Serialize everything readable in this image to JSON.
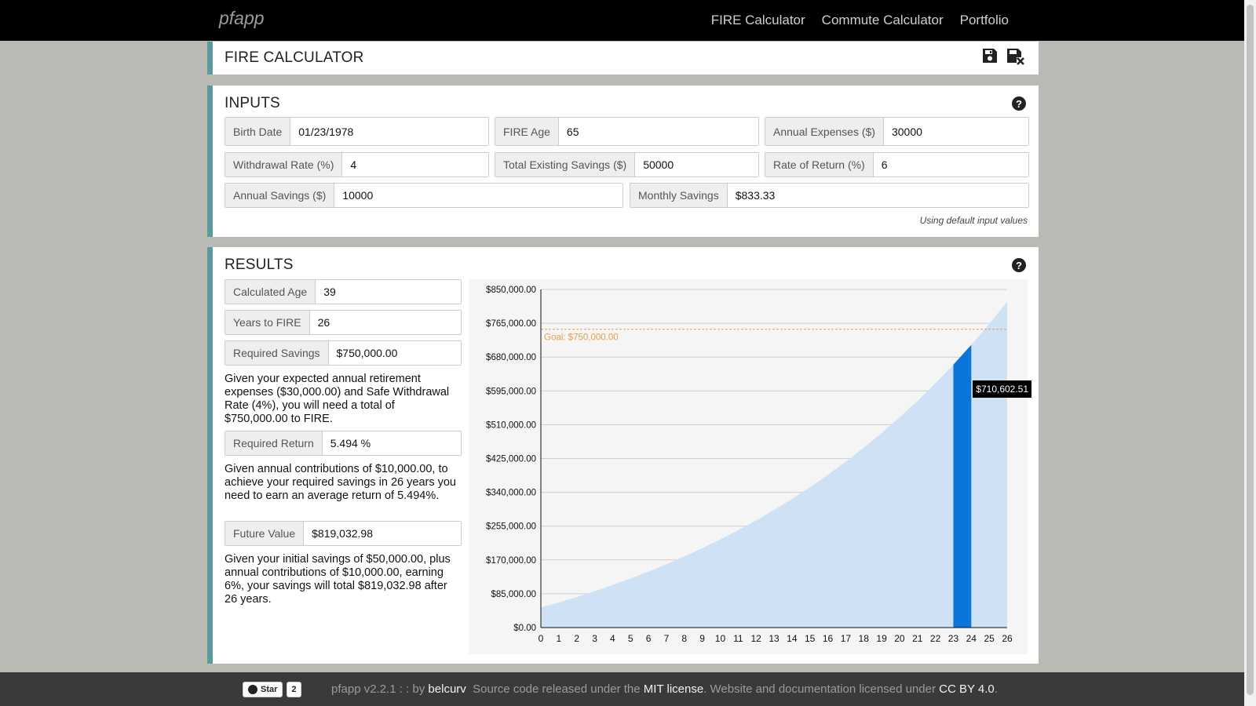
{
  "nav": {
    "brand": "pfapp",
    "links": [
      "FIRE Calculator",
      "Commute Calculator",
      "Portfolio"
    ]
  },
  "header": {
    "title": "FIRE CALCULATOR"
  },
  "inputs": {
    "title": "INPUTS",
    "birth_date": {
      "label": "Birth Date",
      "value": "01/23/1978"
    },
    "fire_age": {
      "label": "FIRE Age",
      "value": "65"
    },
    "annual_expenses": {
      "label": "Annual Expenses ($)",
      "value": "30000"
    },
    "withdrawal_rate": {
      "label": "Withdrawal Rate (%)",
      "value": "4"
    },
    "total_savings": {
      "label": "Total Existing Savings ($)",
      "value": "50000"
    },
    "rate_of_return": {
      "label": "Rate of Return (%)",
      "value": "6"
    },
    "annual_savings": {
      "label": "Annual Savings ($)",
      "value": "10000"
    },
    "monthly_savings": {
      "label": "Monthly Savings",
      "value": "$833.33"
    },
    "note": "Using default input values"
  },
  "results": {
    "title": "RESULTS",
    "calculated_age": {
      "label": "Calculated Age",
      "value": "39"
    },
    "years_to_fire": {
      "label": "Years to FIRE",
      "value": "26"
    },
    "required_savings": {
      "label": "Required Savings",
      "value": "$750,000.00"
    },
    "required_savings_text": "Given your expected annual retirement expenses ($30,000.00) and Safe Withdrawal Rate (4%), you will need a total of $750,000.00 to FIRE.",
    "required_return": {
      "label": "Required Return",
      "value": "5.494 %"
    },
    "required_return_text": "Given annual contributions of $10,000.00, to achieve your required savings in 26 years you need to earn an average return of 5.494%.",
    "future_value": {
      "label": "Future Value",
      "value": "$819,032.98"
    },
    "future_value_text": "Given your initial savings of $50,000.00, plus annual contributions of $10,000.00, earning 6%, your savings will total $819,032.98 after 26 years."
  },
  "chart_data": {
    "type": "area",
    "x": [
      0,
      1,
      2,
      3,
      4,
      5,
      6,
      7,
      8,
      9,
      10,
      11,
      12,
      13,
      14,
      15,
      16,
      17,
      18,
      19,
      20,
      21,
      22,
      23,
      24,
      25,
      26
    ],
    "series": [
      {
        "values": [
          50000,
          63000,
          76780,
          91387,
          106870,
          123290,
          140690,
          159130,
          178680,
          199400,
          221360,
          244640,
          269320,
          295480,
          323210,
          352590,
          383750,
          416770,
          451770,
          488880,
          528210,
          569900,
          614090,
          660940,
          710600,
          763240,
          819030
        ]
      }
    ],
    "highlight": {
      "index": 24,
      "label": "$710,602.51",
      "color": "#0a76d8"
    },
    "goal": {
      "value": 750000,
      "label": "Goal: $750,000.00",
      "color": "#e8a04c"
    },
    "yticks": [
      "$0.00",
      "$85,000.00",
      "$170,000.00",
      "$255,000.00",
      "$340,000.00",
      "$425,000.00",
      "$510,000.00",
      "$595,000.00",
      "$680,000.00",
      "$765,000.00",
      "$850,000.00"
    ],
    "ylim": [
      0,
      850000
    ],
    "xlim": [
      0,
      26
    ],
    "fill_color": "#cfe1f4",
    "grid": true
  },
  "footer": {
    "star_label": "Star",
    "star_count": "2",
    "version": "pfapp v2.2.1 : : by",
    "author": "belcurv",
    "source_text": "Source code released under the",
    "mit": "MIT license",
    "docs_text": ". Website and documentation licensed under",
    "cc": "CC BY 4.0",
    "end": "."
  }
}
